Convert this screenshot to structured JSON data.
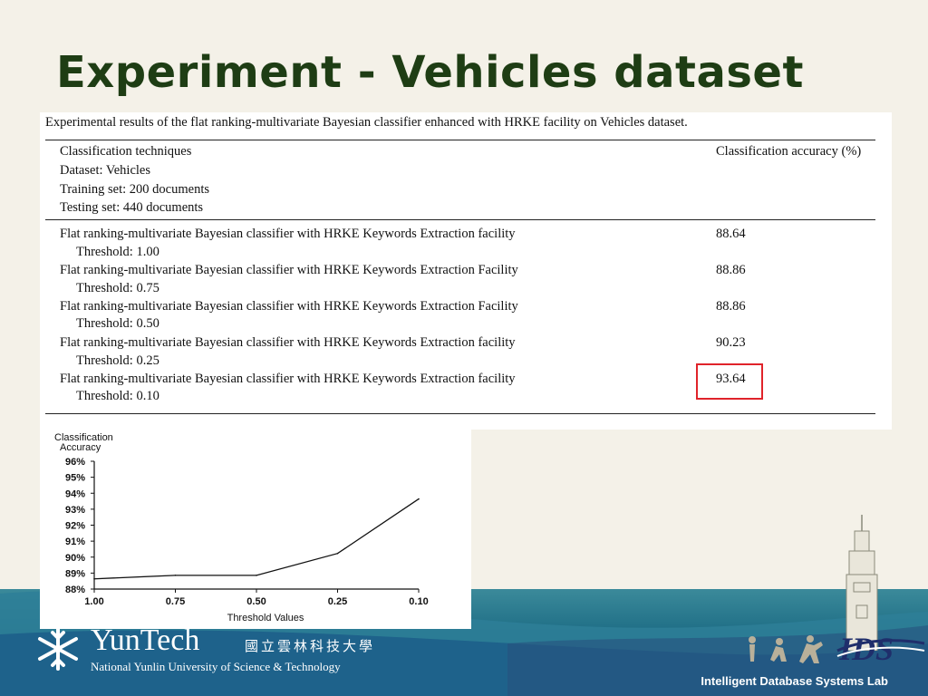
{
  "slide": {
    "title": "Experiment - Vehicles dataset",
    "footer_lab": "Intelligent Database Systems Lab"
  },
  "table": {
    "caption": "Experimental results of the flat ranking-multivariate Bayesian classifier enhanced with HRKE facility on Vehicles dataset.",
    "header_left": [
      "Classification techniques",
      "Dataset: Vehicles",
      "Training set: 200 documents",
      "Testing set: 440 documents"
    ],
    "header_right": "Classification accuracy (%)",
    "rows": [
      {
        "name": "Flat ranking-multivariate Bayesian classifier with HRKE Keywords Extraction facility",
        "threshold": "Threshold: 1.00",
        "value": "88.64"
      },
      {
        "name": "Flat ranking-multivariate Bayesian classifier with HRKE Keywords Extraction Facility",
        "threshold": "Threshold: 0.75",
        "value": "88.86"
      },
      {
        "name": "Flat ranking-multivariate Bayesian classifier with HRKE Keywords Extraction Facility",
        "threshold": "Threshold: 0.50",
        "value": "88.86"
      },
      {
        "name": "Flat ranking-multivariate Bayesian classifier with HRKE Keywords Extraction facility",
        "threshold": "Threshold: 0.25",
        "value": "90.23"
      },
      {
        "name": "Flat ranking-multivariate Bayesian classifier with HRKE Keywords Extraction facility",
        "threshold": "Threshold: 0.10",
        "value": "93.64",
        "highlighted": true
      }
    ]
  },
  "chart_data": {
    "type": "line",
    "ylabel_lines": [
      "Classification",
      "Accuracy"
    ],
    "xlabel": "Threshold Values",
    "categories": [
      "1.00",
      "0.75",
      "0.50",
      "0.25",
      "0.10"
    ],
    "values": [
      88.64,
      88.86,
      88.86,
      90.23,
      93.64
    ],
    "ylim": [
      88,
      96
    ],
    "yticks": [
      "88%",
      "89%",
      "90%",
      "91%",
      "92%",
      "93%",
      "94%",
      "95%",
      "96%"
    ],
    "grid": false
  },
  "logo": {
    "name": "YunTech",
    "chinese": "國立雲林科技大學",
    "subtitle": "National Yunlin University of Science & Technology",
    "lab_logo": "IDS"
  },
  "colors": {
    "title": "#1e3d14",
    "highlight": "#e0232a",
    "band": "#1f6e86"
  },
  "icons": [
    "snowflake-logo-icon",
    "tower-icon",
    "runners-icon",
    "ids-logo-icon"
  ]
}
